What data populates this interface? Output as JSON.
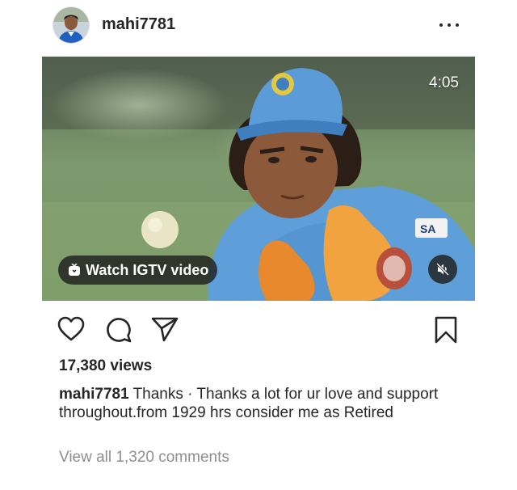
{
  "post": {
    "username": "mahi7781",
    "duration": "4:05",
    "igtv_label": "Watch IGTV video",
    "views": "17,380 views",
    "caption_text": "Thanks · Thanks a lot for ur love and support throughout.from 1929 hrs consider me as Retired",
    "view_comments": "View all 1,320 comments"
  },
  "icons": {
    "more": "more-horizontal-icon",
    "like": "heart-icon",
    "comment": "comment-bubble-icon",
    "share": "paper-plane-icon",
    "save": "bookmark-icon",
    "igtv": "tv-icon",
    "mute": "speaker-muted-icon"
  },
  "colors": {
    "text": "#262626",
    "muted_text": "#8e8e8e",
    "jersey_blue": "#5f9fd9",
    "glove_orange": "#e8892e"
  }
}
